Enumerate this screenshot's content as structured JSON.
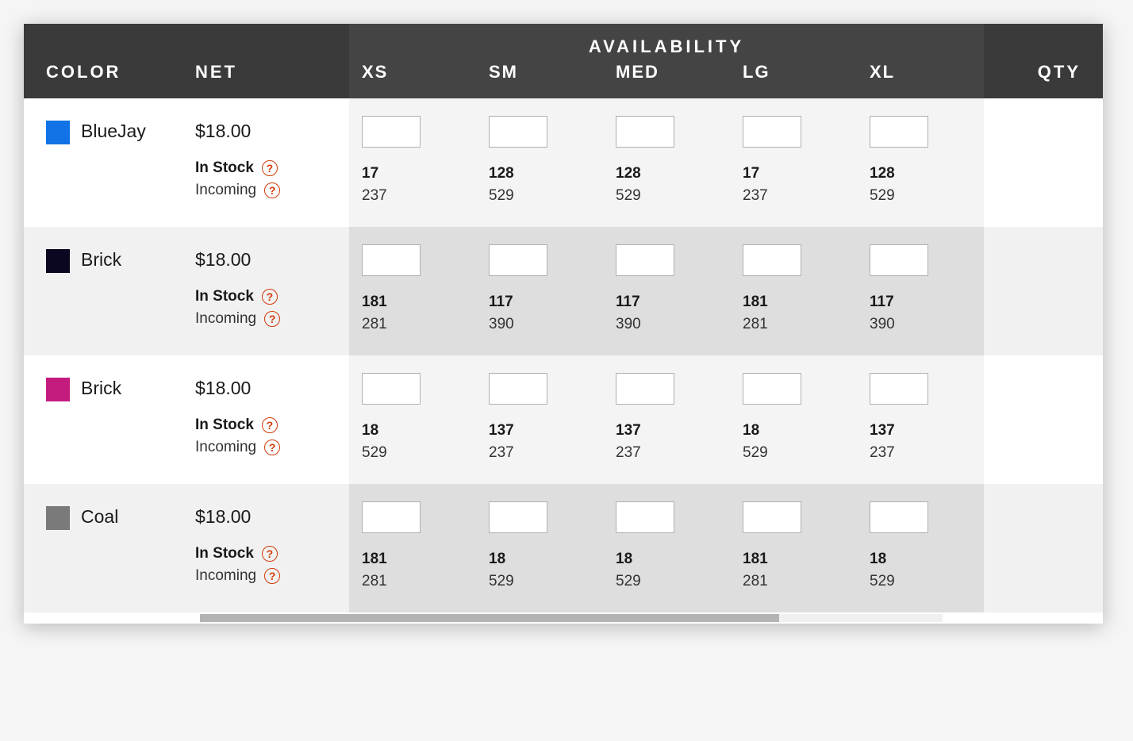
{
  "labels": {
    "color": "COLOR",
    "net": "NET",
    "availability": "AVAILABILITY",
    "qty": "QTY",
    "in_stock": "In Stock",
    "incoming": "Incoming",
    "help_glyph": "?"
  },
  "sizes": [
    "XS",
    "SM",
    "MED",
    "LG",
    "XL"
  ],
  "rows": [
    {
      "color_name": "BlueJay",
      "swatch": "#1273e6",
      "price": "$18.00",
      "in_stock": {
        "XS": "17",
        "SM": "128",
        "MED": "128",
        "LG": "17",
        "XL": "128"
      },
      "incoming": {
        "XS": "237",
        "SM": "529",
        "MED": "529",
        "LG": "237",
        "XL": "529"
      },
      "qty": ""
    },
    {
      "color_name": "Brick",
      "swatch": "#0c0720",
      "price": "$18.00",
      "in_stock": {
        "XS": "181",
        "SM": "117",
        "MED": "117",
        "LG": "181",
        "XL": "117"
      },
      "incoming": {
        "XS": "281",
        "SM": "390",
        "MED": "390",
        "LG": "281",
        "XL": "390"
      },
      "qty": ""
    },
    {
      "color_name": "Brick",
      "swatch": "#c41c7d",
      "price": "$18.00",
      "in_stock": {
        "XS": "18",
        "SM": "137",
        "MED": "137",
        "LG": "18",
        "XL": "137"
      },
      "incoming": {
        "XS": "529",
        "SM": "237",
        "MED": "237",
        "LG": "529",
        "XL": "237"
      },
      "qty": ""
    },
    {
      "color_name": "Coal",
      "swatch": "#7a7a7a",
      "price": "$18.00",
      "in_stock": {
        "XS": "181",
        "SM": "18",
        "MED": "18",
        "LG": "181",
        "XL": "18"
      },
      "incoming": {
        "XS": "281",
        "SM": "529",
        "MED": "529",
        "LG": "281",
        "XL": "529"
      },
      "qty": ""
    }
  ]
}
